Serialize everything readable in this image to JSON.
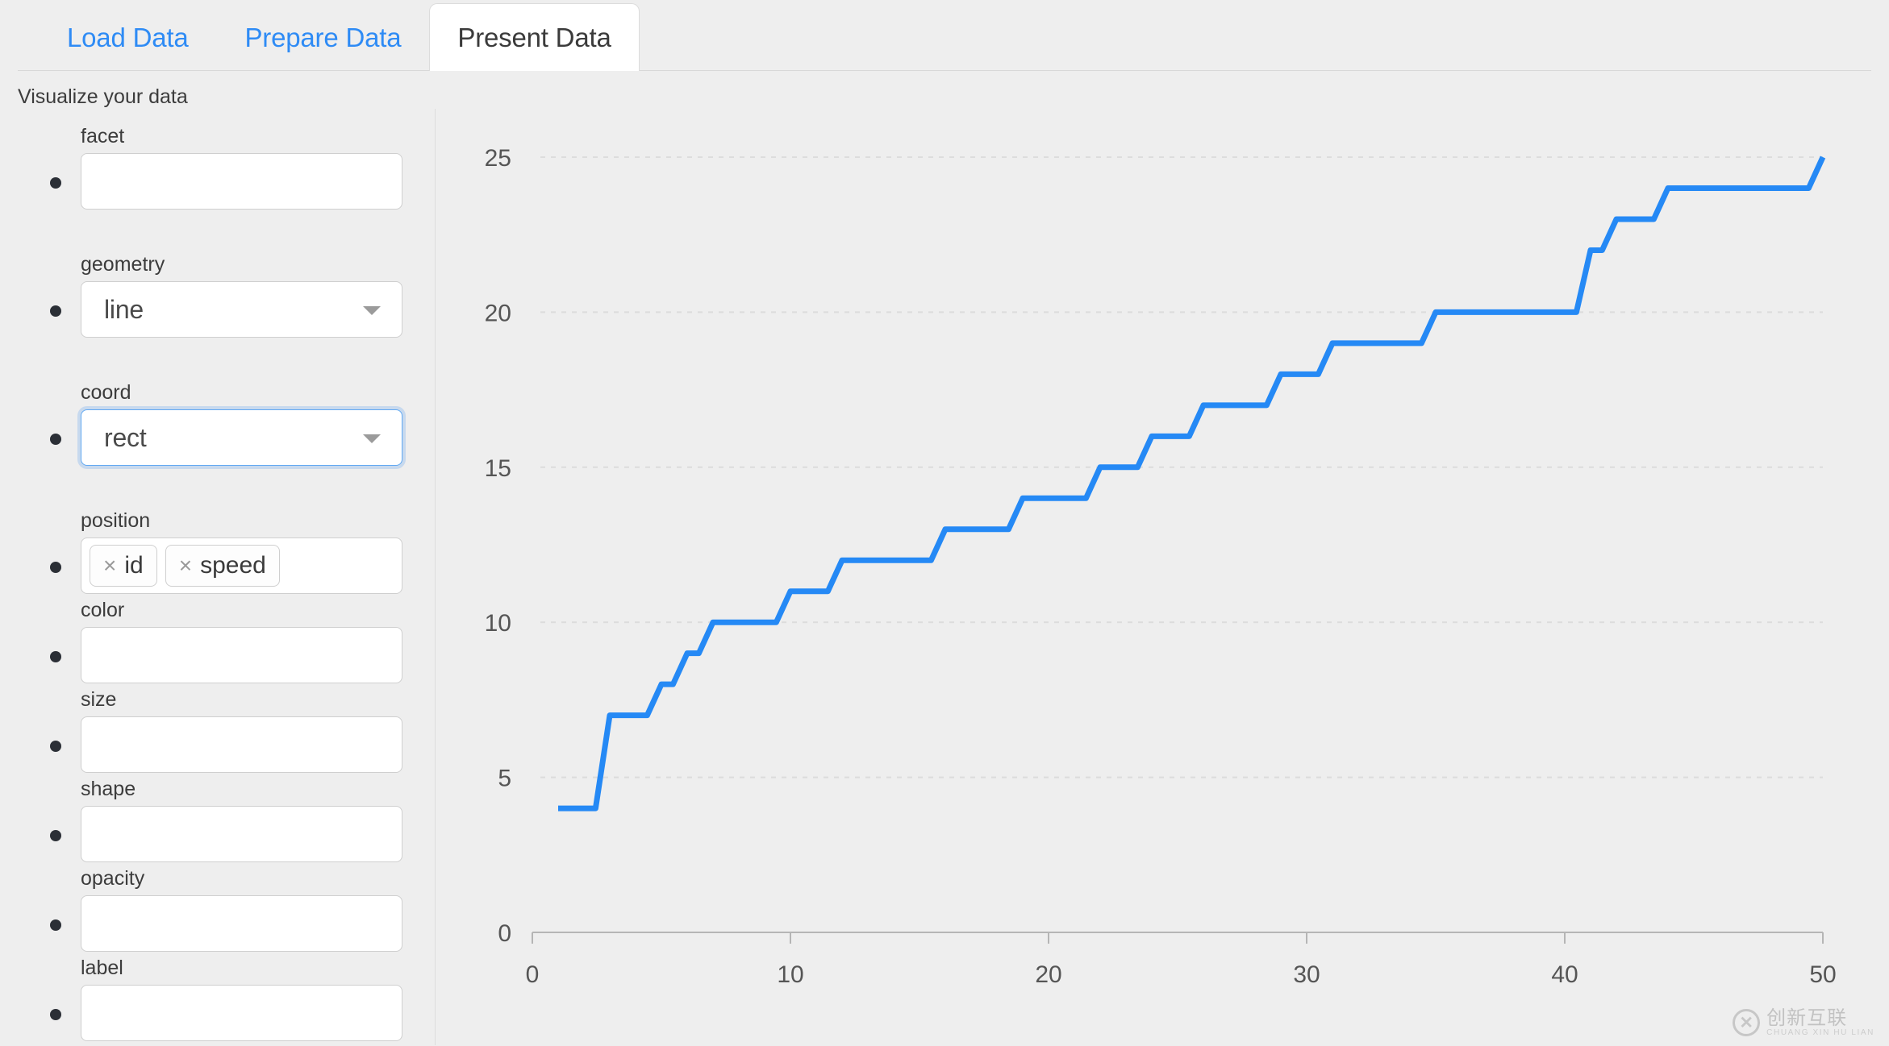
{
  "tabs": [
    {
      "label": "Load Data",
      "active": false
    },
    {
      "label": "Prepare Data",
      "active": false
    },
    {
      "label": "Present Data",
      "active": true
    }
  ],
  "subtitle": "Visualize your data",
  "controls": {
    "fields": [
      {
        "name": "facet",
        "label": "facet",
        "type": "input",
        "value": "",
        "dropdown": false,
        "focused": false
      },
      {
        "name": "geometry",
        "label": "geometry",
        "type": "select",
        "value": "line",
        "dropdown": true,
        "focused": false
      },
      {
        "name": "coord",
        "label": "coord",
        "type": "select",
        "value": "rect",
        "dropdown": true,
        "focused": true
      },
      {
        "name": "position",
        "label": "position",
        "type": "tags",
        "tags": [
          "id",
          "speed"
        ],
        "remove_glyph": "×",
        "dropdown": false,
        "focused": false
      },
      {
        "name": "color",
        "label": "color",
        "type": "input",
        "value": "",
        "dropdown": false,
        "focused": false
      },
      {
        "name": "size",
        "label": "size",
        "type": "input",
        "value": "",
        "dropdown": false,
        "focused": false
      },
      {
        "name": "shape",
        "label": "shape",
        "type": "input",
        "value": "",
        "dropdown": false,
        "focused": false
      },
      {
        "name": "opacity",
        "label": "opacity",
        "type": "input",
        "value": "",
        "dropdown": false,
        "focused": false
      },
      {
        "name": "label",
        "label": "label",
        "type": "input",
        "value": "",
        "dropdown": false,
        "focused": false
      }
    ]
  },
  "colors": {
    "accent": "#2e8bf5",
    "line": "#2589f5",
    "page_bg": "#eeeeee",
    "field_bg": "#ffffff",
    "field_border": "#cfcfcf",
    "focus_border": "#62a9f2",
    "axis": "#b5b5b5",
    "grid": "#dcdcdc",
    "tick_text": "#555555"
  },
  "watermark": {
    "cn": "创新互联",
    "en": "CHUANG XIN HU LIAN",
    "mark": "✕"
  },
  "chart_data": {
    "type": "line",
    "title": "",
    "xlabel": "",
    "ylabel": "",
    "xlim": [
      0,
      50
    ],
    "ylim": [
      0,
      25
    ],
    "xticks": [
      0,
      10,
      20,
      30,
      40,
      50
    ],
    "yticks": [
      0,
      5,
      10,
      15,
      20,
      25
    ],
    "grid": true,
    "grid_axis": "y",
    "legend": false,
    "step": true,
    "series": [
      {
        "name": "speed",
        "color": "#2589f5",
        "x": [
          1,
          2,
          3,
          4,
          5,
          6,
          7,
          8,
          9,
          10,
          11,
          12,
          13,
          14,
          15,
          16,
          17,
          18,
          19,
          20,
          21,
          22,
          23,
          24,
          25,
          26,
          27,
          28,
          29,
          30,
          31,
          32,
          33,
          34,
          35,
          36,
          37,
          38,
          39,
          40,
          41,
          42,
          43,
          44,
          45,
          46,
          47,
          48,
          49,
          50
        ],
        "values": [
          4,
          4,
          7,
          7,
          8,
          9,
          10,
          10,
          10,
          11,
          11,
          12,
          12,
          12,
          12,
          13,
          13,
          13,
          14,
          14,
          14,
          15,
          15,
          16,
          16,
          17,
          17,
          17,
          18,
          18,
          19,
          19,
          19,
          19,
          20,
          20,
          20,
          20,
          20,
          20,
          22,
          23,
          23,
          24,
          24,
          24,
          24,
          24,
          24,
          25
        ]
      }
    ]
  }
}
